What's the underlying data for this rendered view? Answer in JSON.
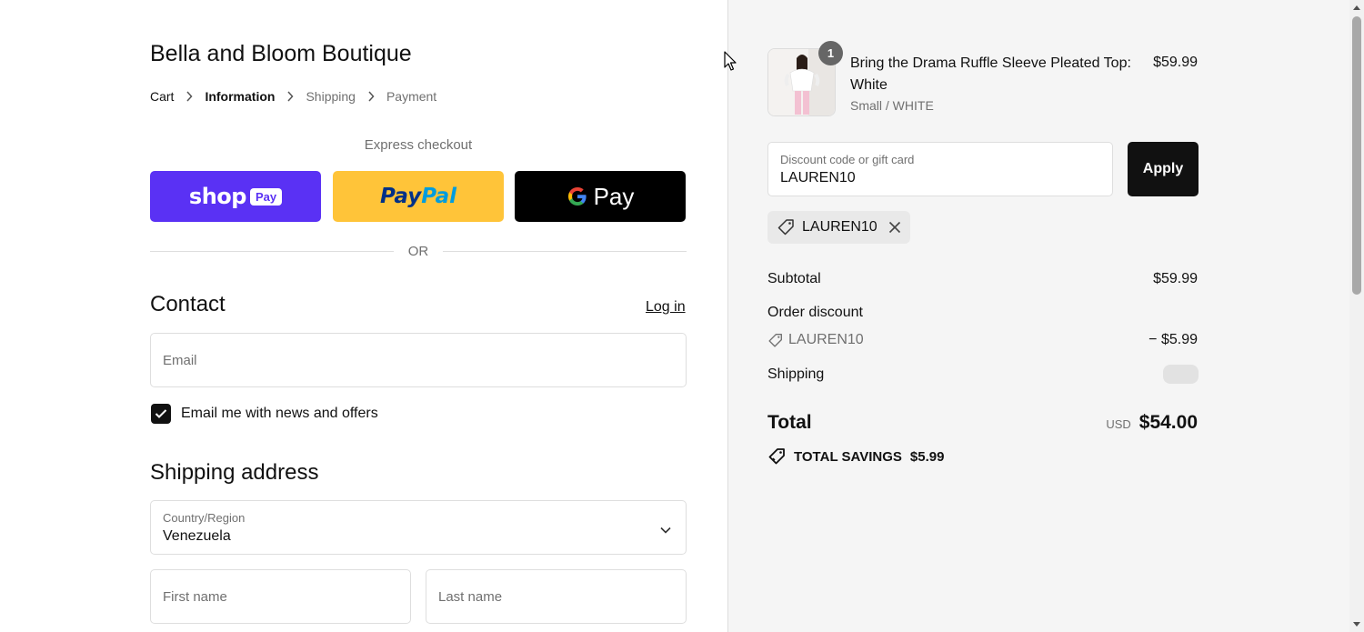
{
  "store": {
    "name": "Bella and Bloom Boutique"
  },
  "breadcrumb": [
    "Cart",
    "Information",
    "Shipping",
    "Payment"
  ],
  "express": {
    "label": "Express checkout",
    "or": "OR",
    "buttons": [
      {
        "name": "shop-pay",
        "text": "shop",
        "badge": "Pay",
        "color": "#5a31f4"
      },
      {
        "name": "paypal",
        "text1": "Pay",
        "text2": "Pal",
        "color": "#ffc439"
      },
      {
        "name": "google-pay",
        "text": "Pay",
        "color": "#000000"
      }
    ]
  },
  "contact": {
    "title": "Contact",
    "login": "Log in",
    "email_placeholder": "Email",
    "newsletter_label": "Email me with news and offers",
    "newsletter_checked": true
  },
  "shipping_address": {
    "title": "Shipping address",
    "country_label": "Country/Region",
    "country_value": "Venezuela",
    "first_name_placeholder": "First name",
    "last_name_placeholder": "Last name"
  },
  "order": {
    "item": {
      "quantity": "1",
      "name": "Bring the Drama Ruffle Sleeve Pleated Top: White",
      "variant": "Small / WHITE",
      "price": "$59.99"
    },
    "discount_field": {
      "label": "Discount code or gift card",
      "value": "LAUREN10"
    },
    "apply": "Apply",
    "applied_code": "LAUREN10",
    "summary": {
      "subtotal_label": "Subtotal",
      "subtotal_value": "$59.99",
      "order_discount_label": "Order discount",
      "discount_code": "LAUREN10",
      "discount_value": "− $5.99",
      "shipping_label": "Shipping",
      "total_label": "Total",
      "total_currency": "USD",
      "total_value": "$54.00",
      "savings_label": "TOTAL SAVINGS",
      "savings_value": "$5.99"
    }
  }
}
